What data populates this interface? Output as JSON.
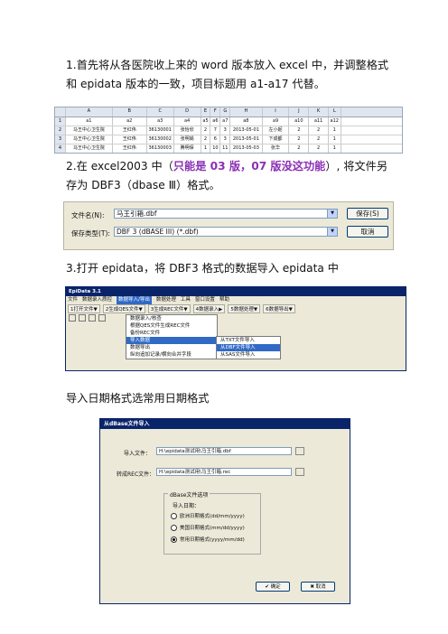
{
  "step1": "1.首先将从各医院收上来的 word 版本放入 excel 中，并调整格式和 epidata 版本的一致，项目标题用 a1-a17 代替。",
  "excel": {
    "col_headers": [
      "A",
      "B",
      "C",
      "D",
      "E",
      "F",
      "G",
      "H",
      "I",
      "J",
      "K",
      "L"
    ],
    "rows": [
      {
        "num": "1",
        "cells": [
          "a1",
          "a2",
          "a3",
          "a4",
          "a5",
          "a6",
          "a7",
          "a8",
          "a9",
          "a10",
          "a11",
          "a12"
        ]
      },
      {
        "num": "2",
        "cells": [
          "马王中心卫生院",
          "王红伟",
          "36130001",
          "张怡欣",
          "2",
          "7",
          "3",
          "2013-05-01",
          "左小妮",
          "2",
          "2",
          "1"
        ]
      },
      {
        "num": "3",
        "cells": [
          "马王中心卫生院",
          "王红伟",
          "36130002",
          "张明娟",
          "2",
          "6",
          "3",
          "2013-05-01",
          "下成都",
          "2",
          "2",
          "1"
        ]
      },
      {
        "num": "4",
        "cells": [
          "马王中心卫生院",
          "王红伟",
          "36130003",
          "腾明保",
          "1",
          "10",
          "11",
          "2013-05-03",
          "张华",
          "2",
          "2",
          "1"
        ]
      }
    ]
  },
  "step2_prefix": "2.在 excel2003 中（",
  "step2_highlight": "只能是 03 版，07 版没这功能",
  "step2_suffix": "）, 将文件另存为 DBF3（dbase Ⅲ）格式。",
  "save_dialog": {
    "filename_label": "文件名(N):",
    "filename_value": "马王引箱.dbf",
    "type_label": "保存类型(T):",
    "type_value": "DBF 3 (dBASE III) (*.dbf)",
    "save_button": "保存(S)",
    "cancel_button": "取消"
  },
  "step3": "3.打开 epidata，将 DBF3 格式的数据导入 epidata 中",
  "epidata": {
    "title": "EpiData 3.1",
    "menubar": [
      "文件",
      "数据录入质控",
      "数据导入/导出",
      "数据处理",
      "工具",
      "窗口设置",
      "帮助"
    ],
    "active_menu_index": 2,
    "toolbar": [
      "1打开文件▼",
      "2生成QES文件▼",
      "3生成REC文件▼",
      "4数据录入▶",
      "5数据处理▼",
      "6数据导出▼"
    ],
    "menu_items": [
      "数据录入/核查",
      "根据QES文件生成REC文件",
      "备份REC文件",
      "导入数据",
      "数据导出",
      "纵向追加记录/横向合并字段"
    ],
    "submenu_items": [
      "从TXT文件导入",
      "从DBF文件导入",
      "从SAS文件导入"
    ]
  },
  "import_caption": "导入日期格式选常用日期格式",
  "import_dialog": {
    "title": "从dBase文件导入",
    "import_label": "导入文件：",
    "import_path": "H:\\epidata测试用\\马王引箱.dbf",
    "rec_label": "转成REC文件：",
    "rec_path": "H:\\epidata测试用\\马王引箱.rec",
    "group_label": "dBase文件选项",
    "date_label": "导入日期：",
    "options": [
      "欧洲日期格式(dd/mm/yyyy)",
      "美国日期格式(mm/dd/yyyy)",
      "常用日期格式(yyyy/mm/dd)"
    ],
    "selected_option": 2,
    "ok_button": "✔ 确定",
    "cancel_button": "✖ 取消"
  }
}
